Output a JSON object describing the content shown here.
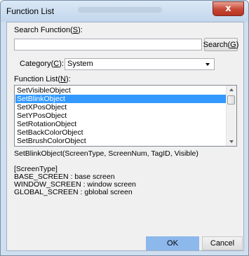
{
  "window": {
    "title": "Function List",
    "close_glyph": "x"
  },
  "search": {
    "label_prefix": "Search Function(",
    "label_key": "S",
    "label_suffix": "):",
    "value": "",
    "button_prefix": "Search(",
    "button_key": "G",
    "button_suffix": ")"
  },
  "category": {
    "label_prefix": "Category(",
    "label_key": "C",
    "label_suffix": "):",
    "selected": "System"
  },
  "function_list": {
    "label_prefix": "Function List(",
    "label_key": "N",
    "label_suffix": "):",
    "items": [
      "SetVisibleObject",
      "SetBlinkObject",
      "SetXPosObject",
      "SetYPosObject",
      "SetRotationObject",
      "SetBackColorObject",
      "SetBrushColorObject"
    ],
    "selected_index": 1
  },
  "description": {
    "signature": "SetBlinkObject(ScreenType, ScreenNum, TagID, Visible)",
    "lines": [
      "[ScreenType]",
      "BASE_SCREEN   : base screen",
      "WINDOW_SCREEN : window screen",
      "GLOBAL_SCREEN : gblobal screen"
    ]
  },
  "footer": {
    "ok_label": "OK",
    "cancel_label": "Cancel"
  },
  "colors": {
    "selection": "#3399ff",
    "ok_button": "#8db8ec",
    "close_button": "#c74634"
  }
}
